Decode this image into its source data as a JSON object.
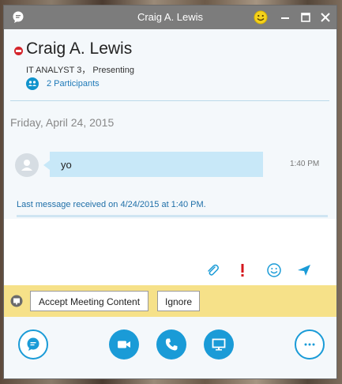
{
  "window": {
    "title": "Craig A. Lewis"
  },
  "contact": {
    "name": "Craig A. Lewis",
    "status_line": "IT ANALYST 3， Presenting",
    "participants": "2 Participants"
  },
  "conversation": {
    "date_header": "Friday, April 24, 2015",
    "messages": [
      {
        "text": "yo",
        "time": "1:40 PM"
      }
    ],
    "last_received": "Last message received on 4/24/2015 at 1:40 PM."
  },
  "banner": {
    "accept_label": "Accept Meeting Content",
    "ignore_label": "Ignore"
  },
  "icons": {
    "titlebar": [
      "chat-bubble-icon",
      "smiley-icon",
      "minimize-icon",
      "maximize-icon",
      "close-icon"
    ],
    "compose": [
      "paperclip-icon",
      "high-importance-icon",
      "emoticon-icon",
      "send-icon"
    ],
    "footer": [
      "im-icon",
      "video-icon",
      "phone-icon",
      "present-screen-icon",
      "more-options-icon"
    ]
  },
  "colors": {
    "titlebar": "#7c7c7c",
    "accent": "#1a9bd7",
    "bubble": "#c8e8f8",
    "banner": "#f6e189",
    "presence_busy": "#d4252c",
    "importance": "#d4161c"
  }
}
